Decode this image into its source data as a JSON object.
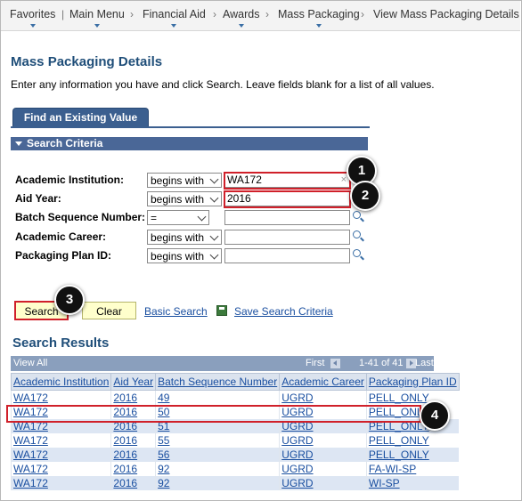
{
  "breadcrumb": [
    "Favorites",
    "Main Menu",
    "Financial Aid",
    "Awards",
    "Mass Packaging",
    "View Mass Packaging Details"
  ],
  "page_title": "Mass Packaging Details",
  "instructions": "Enter any information you have and click Search. Leave fields blank for a list of all values.",
  "tab_label": "Find an Existing Value",
  "section_title": "Search Criteria",
  "criteria": [
    {
      "label": "Academic Institution:",
      "operator": "begins with",
      "value": "WA172"
    },
    {
      "label": "Aid Year:",
      "operator": "begins with",
      "value": "2016"
    },
    {
      "label": "Batch Sequence Number:",
      "operator": "=",
      "value": ""
    },
    {
      "label": "Academic Career:",
      "operator": "begins with",
      "value": ""
    },
    {
      "label": "Packaging Plan ID:",
      "operator": "begins with",
      "value": ""
    }
  ],
  "buttons": {
    "search": "Search",
    "clear": "Clear",
    "basic_search": "Basic Search",
    "save_search": "Save Search Criteria"
  },
  "results": {
    "title": "Search Results",
    "view_all": "View All",
    "first": "First",
    "range": "1-41 of 41",
    "last": "Last",
    "columns": [
      "Academic Institution",
      "Aid Year",
      "Batch Sequence Number",
      "Academic Career",
      "Packaging Plan ID"
    ],
    "rows": [
      [
        "WA172",
        "2016",
        "49",
        "UGRD",
        "PELL_ONLY"
      ],
      [
        "WA172",
        "2016",
        "50",
        "UGRD",
        "PELL_ONLY"
      ],
      [
        "WA172",
        "2016",
        "51",
        "UGRD",
        "PELL_ONLY"
      ],
      [
        "WA172",
        "2016",
        "55",
        "UGRD",
        "PELL_ONLY"
      ],
      [
        "WA172",
        "2016",
        "56",
        "UGRD",
        "PELL_ONLY"
      ],
      [
        "WA172",
        "2016",
        "92",
        "UGRD",
        "FA-WI-SP"
      ],
      [
        "WA172",
        "2016",
        "92",
        "UGRD",
        "WI-SP"
      ]
    ]
  },
  "callouts": [
    "1",
    "2",
    "3",
    "4"
  ],
  "colors": {
    "accent": "#1f4e79",
    "tab": "#3b5f8f",
    "highlight": "#d0202a",
    "button": "#ffffcc"
  }
}
